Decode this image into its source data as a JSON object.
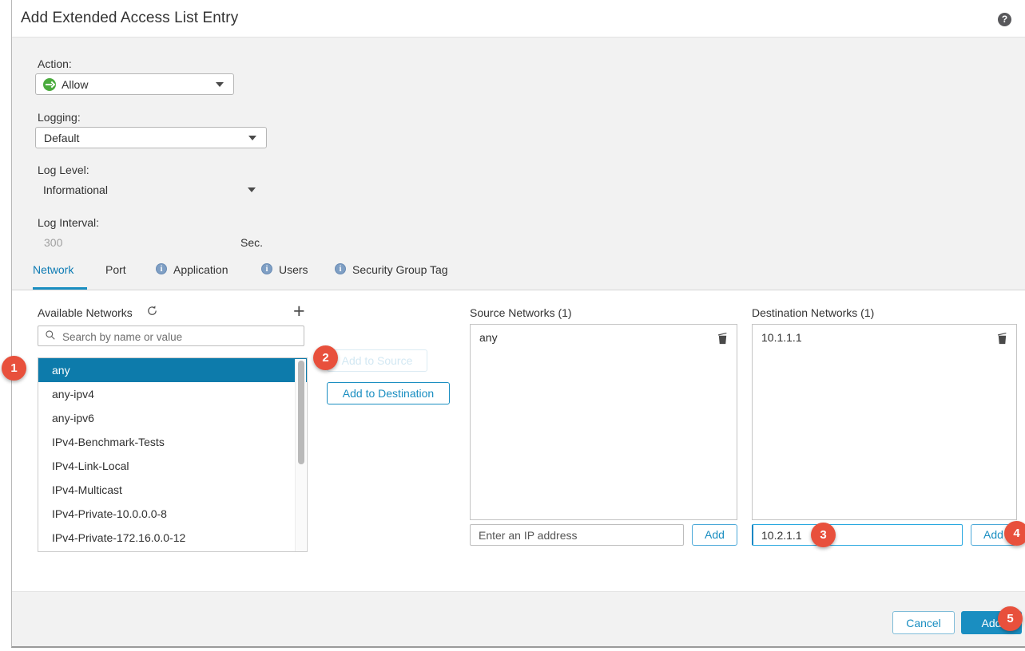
{
  "dialog": {
    "title": "Add Extended Access List Entry",
    "help_icon": "help-icon",
    "help_glyph": "?"
  },
  "form": {
    "action_label": "Action:",
    "action_value": "Allow",
    "logging_label": "Logging:",
    "logging_value": "Default",
    "log_level_label": "Log Level:",
    "log_level_value": "Informational",
    "log_interval_label": "Log Interval:",
    "log_interval_value": "300",
    "log_interval_unit": "Sec."
  },
  "tabs": [
    {
      "label": "Network",
      "active": true,
      "info": false
    },
    {
      "label": "Port",
      "active": false,
      "info": false
    },
    {
      "label": "Application",
      "active": false,
      "info": true
    },
    {
      "label": "Users",
      "active": false,
      "info": true
    },
    {
      "label": "Security Group Tag",
      "active": false,
      "info": true
    }
  ],
  "available": {
    "title": "Available Networks",
    "refresh_icon": "refresh-icon",
    "add_icon": "plus-icon",
    "search_placeholder": "Search by name or value",
    "search_value": "",
    "search_icon": "search-icon",
    "items": [
      {
        "label": "any",
        "selected": true
      },
      {
        "label": "any-ipv4",
        "selected": false
      },
      {
        "label": "any-ipv6",
        "selected": false
      },
      {
        "label": "IPv4-Benchmark-Tests",
        "selected": false
      },
      {
        "label": "IPv4-Link-Local",
        "selected": false
      },
      {
        "label": "IPv4-Multicast",
        "selected": false
      },
      {
        "label": "IPv4-Private-10.0.0.0-8",
        "selected": false
      },
      {
        "label": "IPv4-Private-172.16.0.0-12",
        "selected": false
      }
    ]
  },
  "transfer": {
    "add_to_source_label": "Add to Source",
    "add_to_source_disabled": true,
    "add_to_destination_label": "Add to Destination"
  },
  "source": {
    "title": "Source Networks (1)",
    "entry": "any",
    "trash_icon": "trash-icon",
    "ip_placeholder": "Enter an IP address",
    "ip_value": "",
    "add_label": "Add"
  },
  "destination": {
    "title": "Destination Networks (1)",
    "entry": "10.1.1.1",
    "trash_icon": "trash-icon",
    "ip_placeholder": "",
    "ip_value": "10.2.1.1",
    "add_label": "Add"
  },
  "footer": {
    "cancel_label": "Cancel",
    "add_label": "Add"
  },
  "markers": [
    {
      "n": "1"
    },
    {
      "n": "2"
    },
    {
      "n": "3"
    },
    {
      "n": "4"
    },
    {
      "n": "5"
    }
  ],
  "colors": {
    "accent_blue": "#1a8ec1",
    "selected_blue": "#0d7bab",
    "allow_green": "#4aab3d",
    "marker_red": "#e8503c",
    "body_gray": "#f2f2f2"
  }
}
